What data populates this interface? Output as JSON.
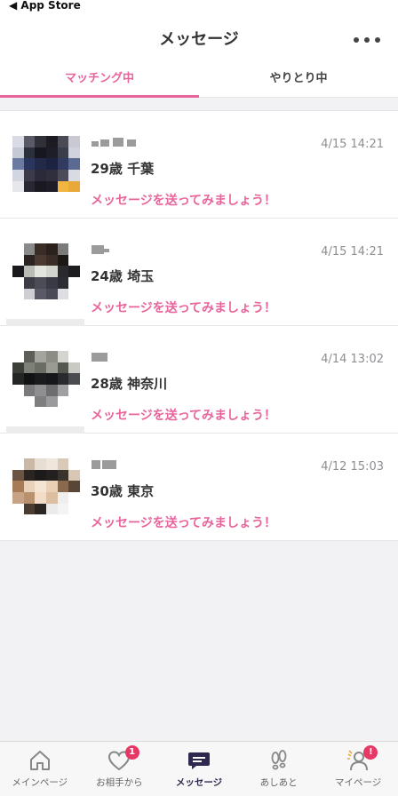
{
  "status_bar": {
    "back_label": "◀ App Store"
  },
  "header": {
    "title": "メッセージ"
  },
  "tabs": [
    {
      "label": "マッチング中",
      "active": true
    },
    {
      "label": "やりとり中",
      "active": false
    }
  ],
  "messages": [
    {
      "age_location": "29歳 千葉",
      "date": "4/15 14:21",
      "prompt": "メッセージを送ってみましょう！",
      "avatar_colors": [
        "#d8dbe4",
        "#5a5a66",
        "#303039",
        "#1c1b22",
        "#4a4b55",
        "#c8c9d2",
        "#c5c9d4",
        "#2c2f3c",
        "#161720",
        "#1d1e27",
        "#3a3d4a",
        "#d0d3dc",
        "#6a7aa0",
        "#2a3560",
        "#232a48",
        "#1c2242",
        "#323a62",
        "#5b6a92",
        "#d2d6e0",
        "#3b3b4a",
        "#2a2a3a",
        "#2f2f3e",
        "#4b4b5a",
        "#d9dbe2",
        "#e6e7ec",
        "#282733",
        "#1a1922",
        "#1e1d27",
        "#f0b640",
        "#e8a93a"
      ]
    },
    {
      "age_location": "24歳 埼玉",
      "date": "4/15 14:21",
      "prompt": "メッセージを送ってみましょう！",
      "avatar_colors": [
        "#ffffff",
        "#8a8a8a",
        "#3a2d28",
        "#2a201c",
        "#7b7b7b",
        "#ffffff",
        "#ffffff",
        "#2b2420",
        "#4a3a32",
        "#3a2d28",
        "#1c1816",
        "#ffffff",
        "#1a1a1c",
        "#b9bcb5",
        "#e2e4de",
        "#d2d4ce",
        "#2a2a2e",
        "#1d1d20",
        "#ffffff",
        "#3c3c44",
        "#4c4c56",
        "#3a3a44",
        "#2c2c33",
        "#ffffff",
        "#ffffff",
        "#cfcfd3",
        "#5a5a66",
        "#4a4a55",
        "#dedee2",
        "#ffffff"
      ]
    },
    {
      "age_location": "28歳 神奈川",
      "date": "4/14 13:02",
      "prompt": "メッセージを送ってみましょう！",
      "avatar_colors": [
        "#ffffff",
        "#5c5f57",
        "#a3a49b",
        "#8c8d84",
        "#d4d4d0",
        "#ffffff",
        "#3c3f38",
        "#7d8077",
        "#6a6d64",
        "#9a9b93",
        "#55584f",
        "#c9cac4",
        "#242525",
        "#111214",
        "#1a1b1e",
        "#16171a",
        "#2a2b2e",
        "#4b4c4f",
        "#ffffff",
        "#7a7a7c",
        "#8f8f92",
        "#6d6d70",
        "#a0a0a3",
        "#ffffff",
        "#ffffff",
        "#ffffff",
        "#7e7e80",
        "#9a9a9c",
        "#ffffff",
        "#ffffff"
      ]
    },
    {
      "age_location": "30歳 東京",
      "date": "4/12 15:03",
      "prompt": "メッセージを送ってみましょう！",
      "avatar_colors": [
        "#ffffff",
        "#c9b8a6",
        "#e8ddd1",
        "#efe6dc",
        "#d8c9b8",
        "#ffffff",
        "#6a5542",
        "#2a2522",
        "#1c1a1a",
        "#242020",
        "#3a332d",
        "#d9c7b3",
        "#a67c58",
        "#e9d2bb",
        "#f4e4d4",
        "#e8cfb6",
        "#8a6a4e",
        "#5a4636",
        "#c7a284",
        "#b8916f",
        "#f0dcc7",
        "#dcbfa1",
        "#efefef",
        "#ffffff",
        "#ffffff",
        "#4a3c30",
        "#2c2622",
        "#ebebeb",
        "#f4f4f4",
        "#ffffff"
      ]
    }
  ],
  "bottom_tabs": [
    {
      "label": "メインページ",
      "icon": "home-icon",
      "active": false,
      "badge": ""
    },
    {
      "label": "お相手から",
      "icon": "heart-icon",
      "active": false,
      "badge": "1"
    },
    {
      "label": "メッセージ",
      "icon": "chat-icon",
      "active": true,
      "badge": ""
    },
    {
      "label": "あしあと",
      "icon": "footprints-icon",
      "active": false,
      "badge": ""
    },
    {
      "label": "マイページ",
      "icon": "person-icon",
      "active": false,
      "badge": "!"
    }
  ],
  "colors": {
    "accent": "#e8659c",
    "badge": "#e63765",
    "active_tab": "#2f2a4d"
  }
}
